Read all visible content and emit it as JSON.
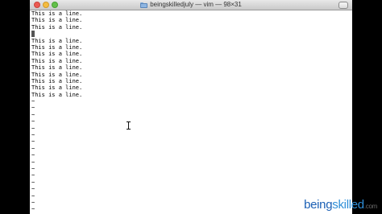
{
  "window": {
    "title": "beingskilledjuly — vim — 98×31",
    "icon": "folder-icon"
  },
  "editor": {
    "lines": [
      "This is a line.",
      "This is a line.",
      "This is a line.",
      "",
      "This is a line.",
      "This is a line.",
      "This is a line.",
      "This is a line.",
      "This is a line.",
      "This is a line.",
      "This is a line.",
      "This is a line.",
      "This is a line."
    ],
    "cursor_line": 4,
    "empty_marker": "~",
    "empty_line_count": 17
  },
  "watermark": {
    "part1": "being",
    "part2": "skilled",
    "part3": ".com"
  },
  "colors": {
    "close": "#ec5a52",
    "minimize": "#f4bc40",
    "maximize": "#63c04a",
    "watermark_primary": "#1a5fb4",
    "watermark_secondary": "#2f8fd8"
  }
}
